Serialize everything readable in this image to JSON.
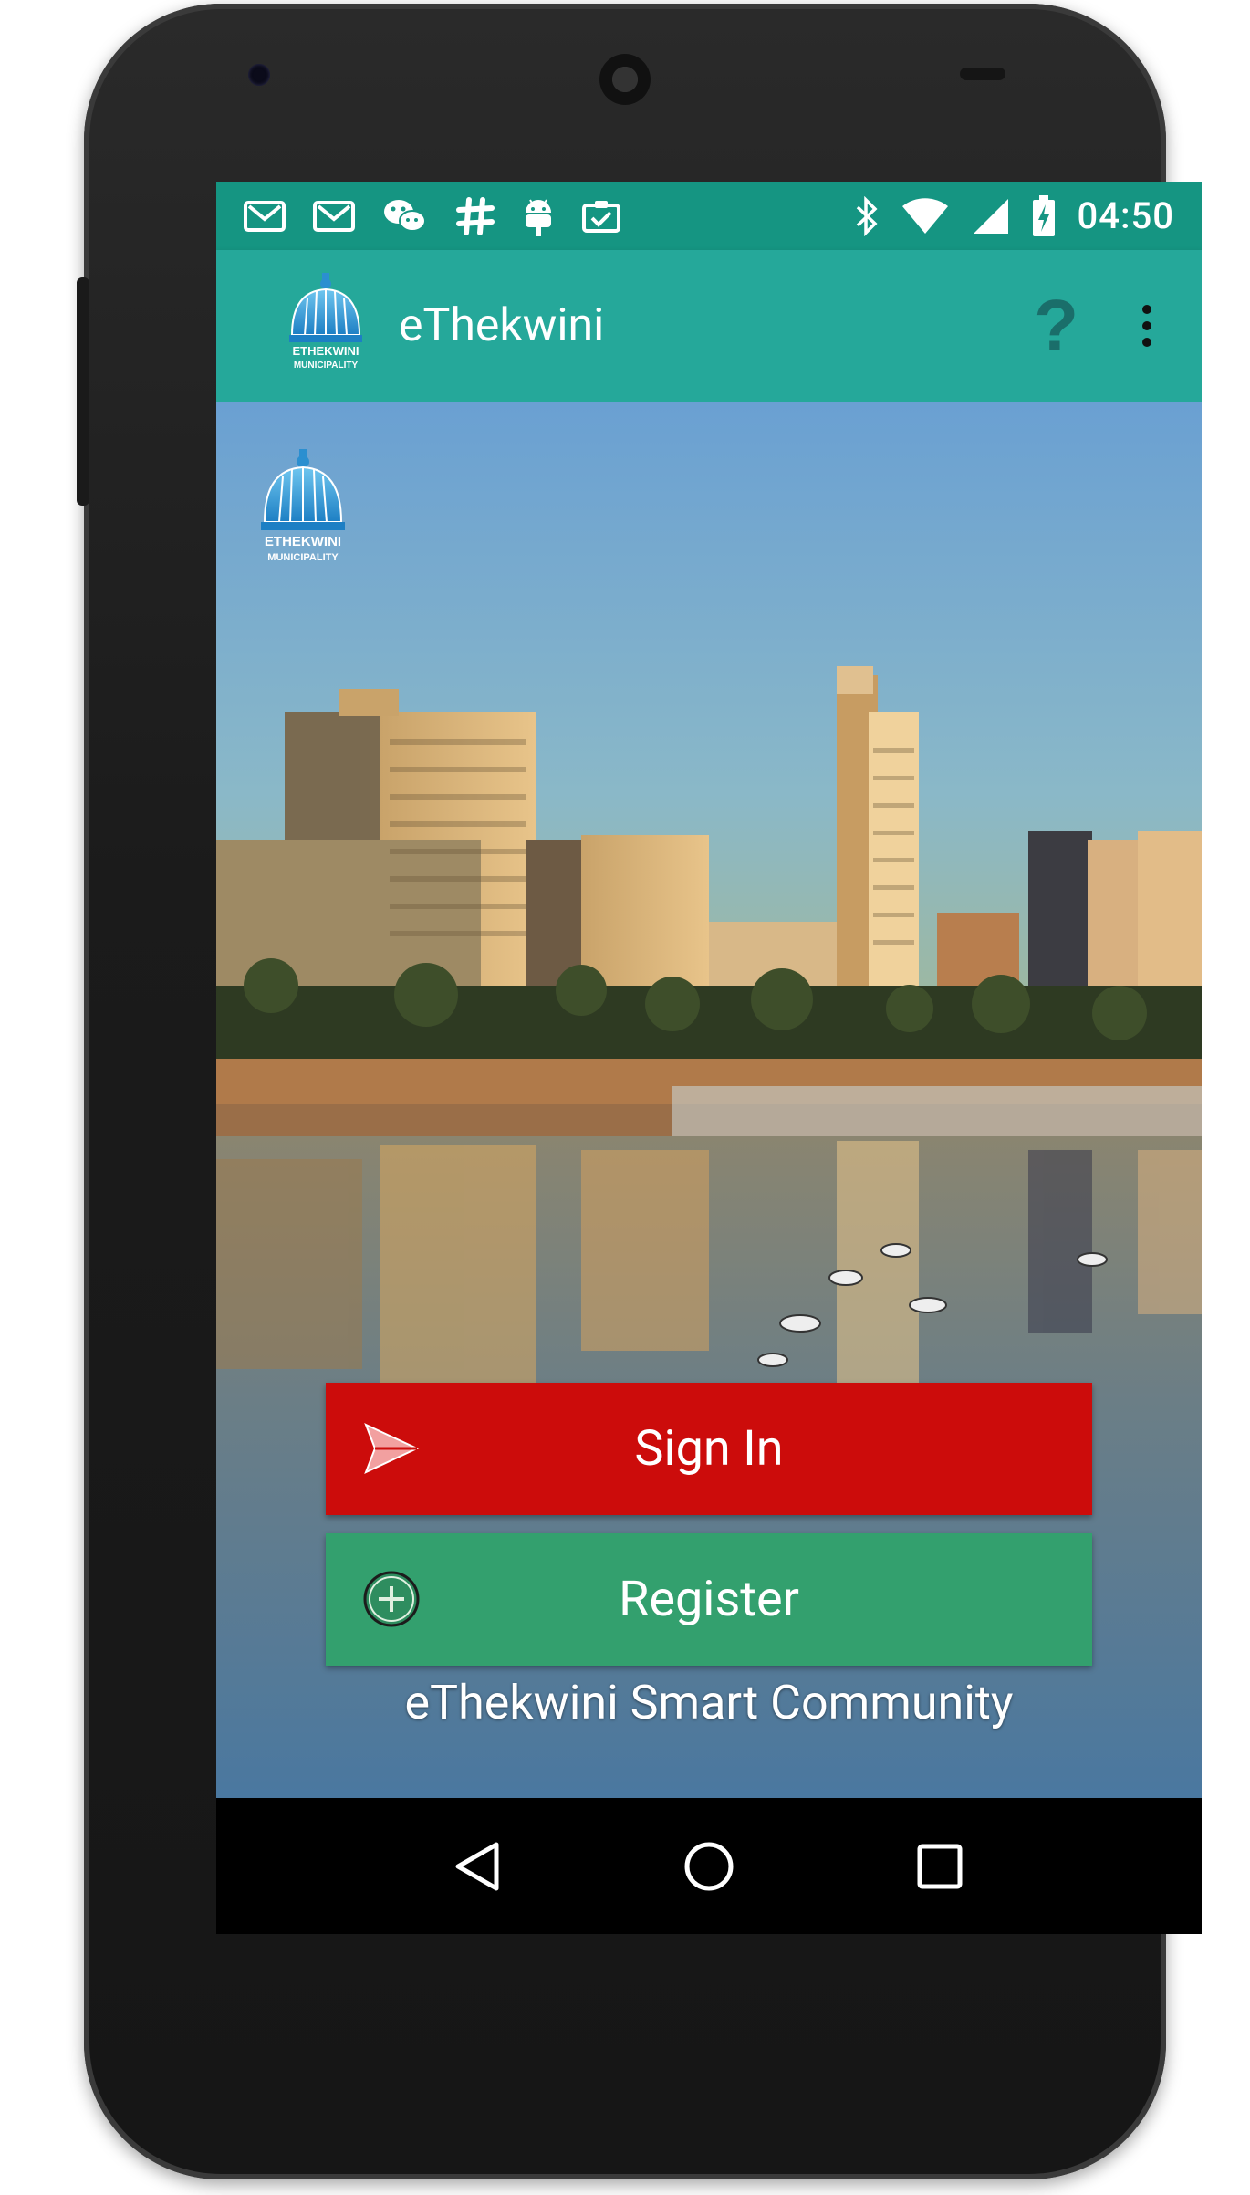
{
  "status_bar": {
    "time": "04:50",
    "notification_icons": [
      "gmail-icon",
      "gmail-icon",
      "wechat-icon",
      "slack-icon",
      "android-debug-icon",
      "clipboard-check-icon"
    ],
    "system_icons": [
      "bluetooth-icon",
      "wifi-icon",
      "cellular-signal-icon",
      "battery-charging-icon"
    ]
  },
  "app_bar": {
    "title": "eThekwini",
    "help_icon": "?",
    "overflow_icon": "more-vert-icon",
    "background": "#25a89a"
  },
  "main": {
    "sign_in_label": "Sign In",
    "register_label": "Register",
    "tagline": "eThekwini Smart Community",
    "sign_in_color": "#cc0c0b",
    "register_color": "#33a06e"
  },
  "logo": {
    "line1": "ETHEKWINI",
    "line2": "MUNICIPALITY"
  },
  "nav_bar": {
    "buttons": [
      "back-icon",
      "home-icon",
      "recents-icon"
    ]
  }
}
